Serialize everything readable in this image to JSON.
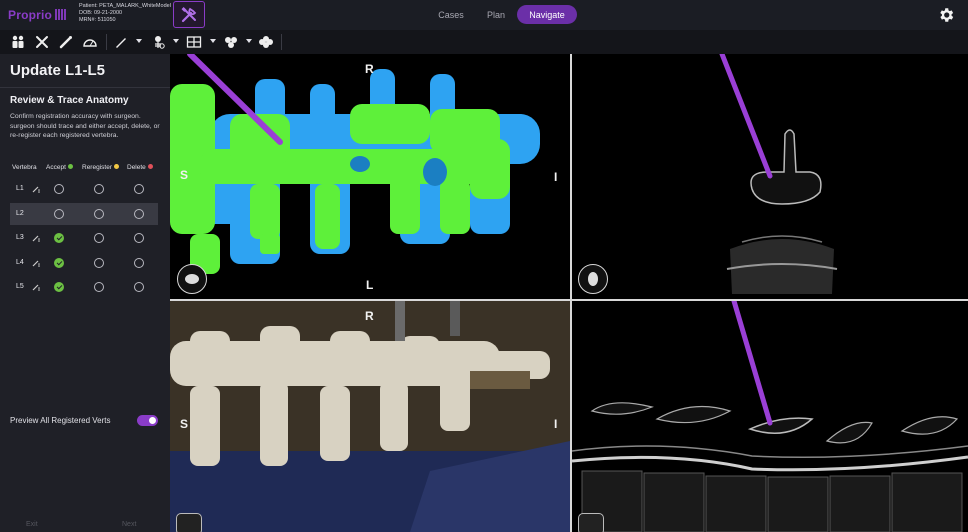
{
  "app": {
    "brand": "Proprio",
    "patient_line": "Patient: PETA_MALARK_WhiteModel",
    "dob_line": "DOB: 09-21-2000",
    "mrn_line": "MRN#: 511050"
  },
  "nav": {
    "cases": "Cases",
    "plan": "Plan",
    "navigate": "Navigate",
    "active": "Navigate"
  },
  "panel": {
    "title": "Update L1-L5",
    "section_title": "Review & Trace Anatomy",
    "description": "Confirm registration accuracy with surgeon. surgeon should trace and either accept, delete, or re-register each registered vertebra.",
    "columns": {
      "vertebra": "Vertebra",
      "accept": "Accept",
      "reregister": "Reregister",
      "delete": "Delete"
    },
    "column_colors": {
      "accept": "#6cc043",
      "reregister": "#f2c744",
      "delete": "#e0505a"
    },
    "rows": [
      {
        "label": "L1",
        "accepted": false
      },
      {
        "label": "L2",
        "accepted": false
      },
      {
        "label": "L3",
        "accepted": true
      },
      {
        "label": "L4",
        "accepted": true
      },
      {
        "label": "L5",
        "accepted": true
      }
    ],
    "highlighted_row": "L2",
    "preview_label": "Preview All Registered Verts",
    "preview_enabled": true,
    "footer_left": "Exit",
    "footer_right": "Next"
  },
  "viewports": {
    "top_left": {
      "top": "R",
      "left": "S",
      "right": "I",
      "bottom": "L"
    },
    "top_right": {
      "right": "I"
    },
    "bottom_left": {
      "top": "R",
      "left": "S",
      "right": "I"
    }
  },
  "colors": {
    "accent": "#8a3cc8",
    "nav_active": "#6b2fa8",
    "vertebra_blue": "#2ea3f2",
    "vertebra_green": "#5ef03a",
    "probe": "#9a3fd6"
  }
}
